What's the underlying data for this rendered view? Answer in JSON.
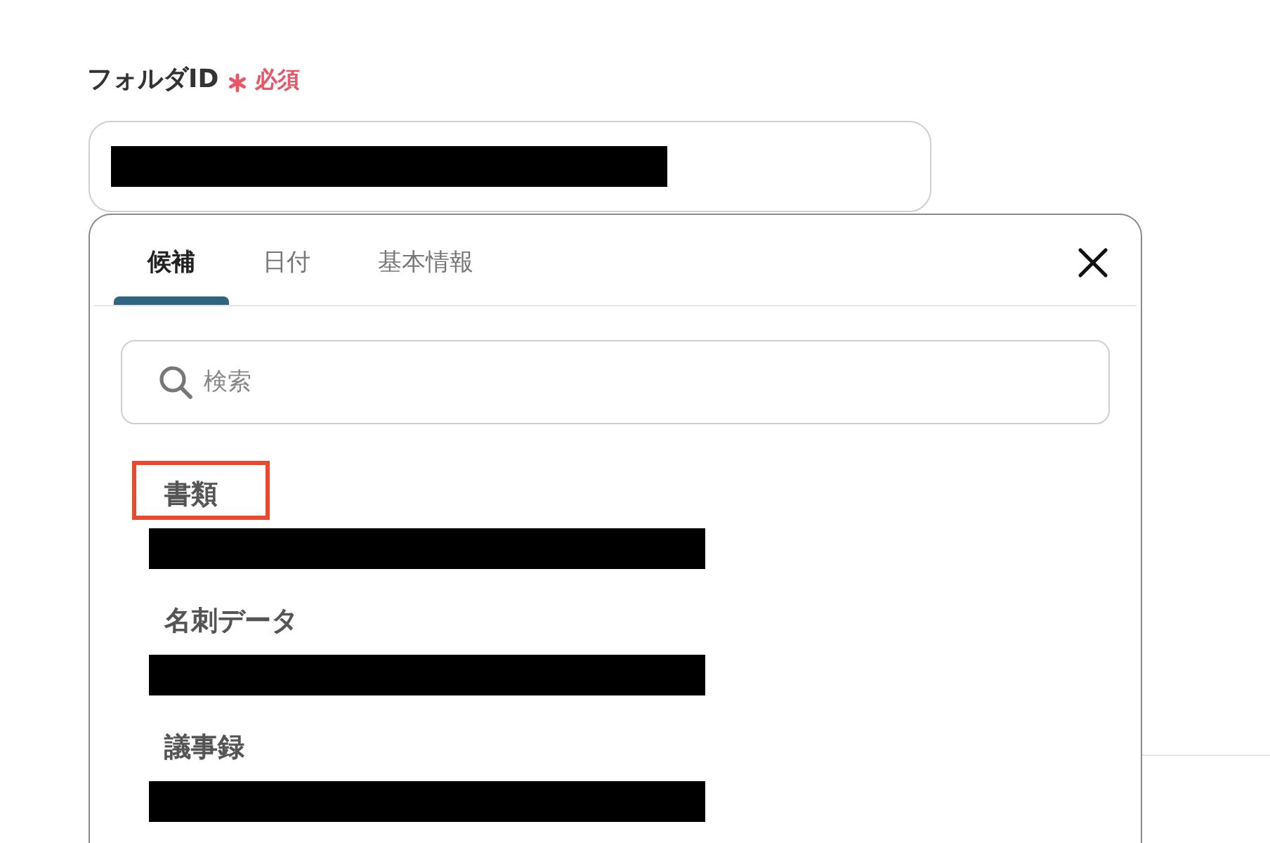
{
  "field": {
    "label": "フォルダID",
    "required": true,
    "required_label": "必須",
    "value_redacted": true
  },
  "panel": {
    "tabs": [
      {
        "label": "候補",
        "selected": true
      },
      {
        "label": "日付",
        "selected": false
      },
      {
        "label": "基本情報",
        "selected": false
      }
    ],
    "search": {
      "placeholder": "検索"
    },
    "items": [
      {
        "name": "書類",
        "highlighted": true,
        "value_redacted": true
      },
      {
        "name": "名刺データ",
        "highlighted": false,
        "value_redacted": true
      },
      {
        "name": "議事録",
        "highlighted": false,
        "value_redacted": true
      }
    ]
  }
}
